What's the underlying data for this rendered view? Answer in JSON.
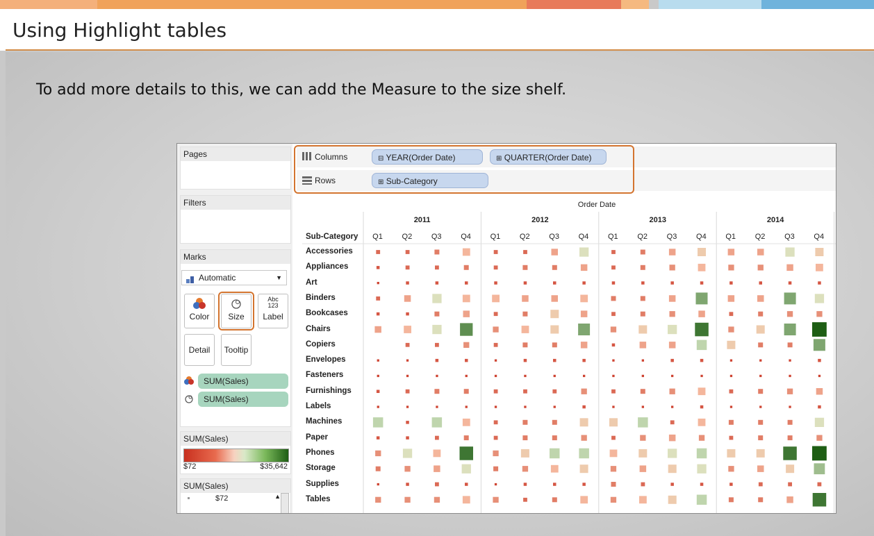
{
  "slide": {
    "title": "Using Highlight tables",
    "lead": "To add more details to this, we can add the Measure to the size shelf.",
    "accent_colors": [
      "#f0a25a",
      "#e87a5a",
      "#9bd0e8"
    ]
  },
  "tableau": {
    "panels": {
      "pages": "Pages",
      "filters": "Filters",
      "marks": "Marks"
    },
    "marks_type": "Automatic",
    "mark_buttons": {
      "color": "Color",
      "size": "Size",
      "label": "Label",
      "label_glyph": "Abc\n123",
      "detail": "Detail",
      "tooltip": "Tooltip"
    },
    "mark_fields": [
      "SUM(Sales)",
      "SUM(Sales)"
    ],
    "color_legend": {
      "title": "SUM(Sales)",
      "min": "$72",
      "max": "$35,642"
    },
    "size_legend": {
      "title": "SUM(Sales)",
      "first_value": "$72"
    },
    "shelves": {
      "columns_label": "Columns",
      "rows_label": "Rows",
      "columns_pills": [
        "YEAR(Order Date)",
        "QUARTER(Order Date)"
      ],
      "rows_pills": [
        "Sub-Category"
      ],
      "pill_icons": [
        "minus-box-icon",
        "plus-box-icon",
        "plus-box-icon"
      ]
    }
  },
  "chart_data": {
    "type": "heatmap",
    "title": "Order Date",
    "row_header": "Sub-Category",
    "years": [
      "2011",
      "2012",
      "2013",
      "2014"
    ],
    "quarters": [
      "Q1",
      "Q2",
      "Q3",
      "Q4"
    ],
    "rows": [
      "Accessories",
      "Appliances",
      "Art",
      "Binders",
      "Bookcases",
      "Chairs",
      "Copiers",
      "Envelopes",
      "Fasteners",
      "Furnishings",
      "Labels",
      "Machines",
      "Paper",
      "Phones",
      "Storage",
      "Supplies",
      "Tables"
    ],
    "color_range": {
      "min": 72,
      "max": 35642,
      "low_color": "#c8301f",
      "mid_color": "#f7c0a5",
      "high_color": "#1e5e14"
    },
    "values": [
      [
        3,
        3,
        4,
        7,
        3,
        3,
        6,
        9,
        3,
        4,
        6,
        8,
        6,
        6,
        9,
        8
      ],
      [
        2,
        3,
        3,
        4,
        3,
        4,
        4,
        6,
        3,
        4,
        5,
        7,
        5,
        5,
        6,
        7
      ],
      [
        1,
        2,
        2,
        2,
        2,
        2,
        2,
        2,
        2,
        2,
        2,
        2,
        2,
        2,
        2,
        2
      ],
      [
        3,
        6,
        9,
        7,
        7,
        6,
        6,
        7,
        4,
        4,
        6,
        12,
        6,
        6,
        12,
        9
      ],
      [
        2,
        2,
        4,
        6,
        3,
        4,
        8,
        6,
        3,
        4,
        5,
        6,
        3,
        4,
        5,
        5
      ],
      [
        6,
        7,
        9,
        13,
        5,
        7,
        8,
        12,
        5,
        8,
        9,
        14,
        5,
        8,
        12,
        15
      ],
      [
        0,
        3,
        3,
        5,
        3,
        4,
        4,
        6,
        2,
        6,
        6,
        10,
        8,
        4,
        4,
        12
      ],
      [
        1,
        1,
        2,
        2,
        1,
        2,
        2,
        2,
        1,
        1,
        2,
        2,
        1,
        1,
        1,
        2
      ],
      [
        1,
        1,
        1,
        1,
        1,
        1,
        1,
        1,
        1,
        1,
        1,
        1,
        1,
        1,
        1,
        1
      ],
      [
        2,
        3,
        4,
        4,
        3,
        3,
        3,
        5,
        3,
        4,
        5,
        7,
        3,
        4,
        5,
        6
      ],
      [
        1,
        1,
        1,
        1,
        1,
        1,
        1,
        2,
        1,
        1,
        1,
        2,
        1,
        1,
        1,
        2
      ],
      [
        10,
        2,
        10,
        7,
        3,
        4,
        4,
        8,
        8,
        10,
        3,
        7,
        4,
        4,
        4,
        9
      ],
      [
        2,
        2,
        3,
        4,
        3,
        4,
        4,
        5,
        3,
        5,
        6,
        5,
        3,
        4,
        4,
        5
      ],
      [
        5,
        9,
        7,
        14,
        5,
        8,
        10,
        10,
        7,
        8,
        9,
        10,
        8,
        8,
        14,
        15
      ],
      [
        4,
        5,
        6,
        9,
        4,
        5,
        7,
        8,
        5,
        6,
        8,
        9,
        5,
        6,
        8,
        11
      ],
      [
        1,
        2,
        3,
        2,
        1,
        2,
        2,
        2,
        4,
        3,
        2,
        2,
        2,
        3,
        3,
        3
      ],
      [
        5,
        5,
        5,
        7,
        5,
        3,
        4,
        7,
        5,
        7,
        8,
        10,
        4,
        4,
        6,
        14
      ]
    ]
  }
}
